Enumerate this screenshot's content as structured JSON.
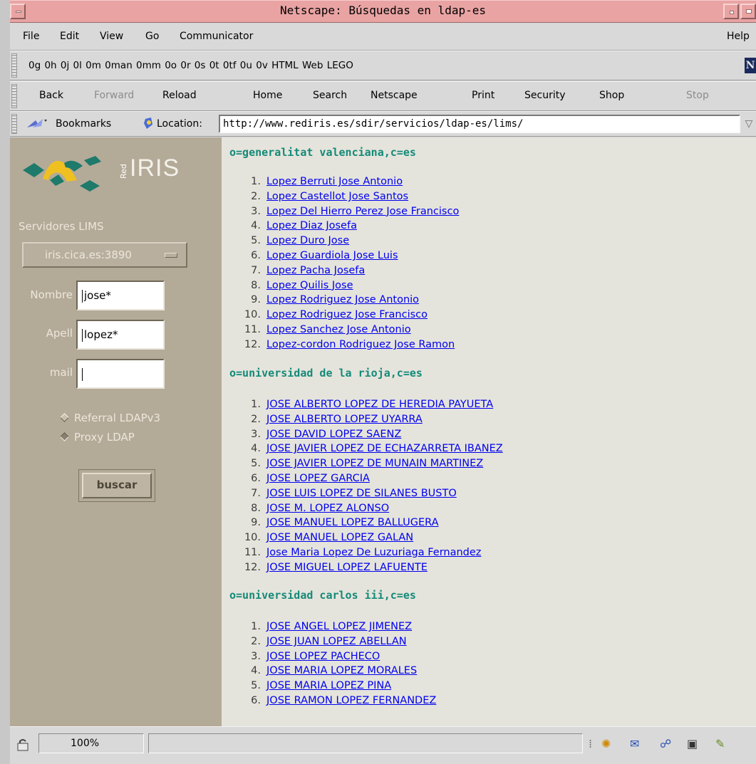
{
  "window": {
    "title": "Netscape: Búsquedas en ldap-es"
  },
  "menubar": {
    "items": [
      "File",
      "Edit",
      "View",
      "Go",
      "Communicator"
    ],
    "help": "Help"
  },
  "personal_toolbar": {
    "links": "0g 0h 0j 0l 0m 0man 0mm 0o 0r 0s 0t 0tf 0u 0v HTML Web LEGO"
  },
  "nav_toolbar": {
    "buttons": [
      "Back",
      "Forward",
      "Reload",
      "Home",
      "Search",
      "Netscape",
      "Print",
      "Security",
      "Shop",
      "Stop"
    ]
  },
  "location_bar": {
    "bookmarks_label": "Bookmarks",
    "location_label": "Location:",
    "url": "http://www.rediris.es/sdir/servicios/ldap-es/lims/"
  },
  "sidebar": {
    "logo_red": "Red",
    "logo_iris": "IRIS",
    "servers_label": "Servidores LIMS",
    "server_selected": "iris.cica.es:3890",
    "nombre_label": "Nombre",
    "nombre_value": "jose*",
    "apell_label": "Apell",
    "apell_value": "lopez*",
    "mail_label": "mail",
    "mail_value": "",
    "radio_referral": "Referral LDAPv3",
    "radio_proxy": "Proxy LDAP",
    "search_button": "buscar"
  },
  "results": [
    {
      "org": "o=generalitat valenciana,c=es",
      "people": [
        "Lopez Berruti Jose Antonio",
        "Lopez Castellot Jose Santos",
        "Lopez Del Hierro Perez Jose Francisco",
        "Lopez Diaz Josefa",
        "Lopez Duro Jose",
        "Lopez Guardiola Jose Luis",
        "Lopez Pacha Josefa",
        "Lopez Quilis Jose",
        "Lopez Rodriguez Jose Antonio",
        "Lopez Rodriguez Jose Francisco",
        "Lopez Sanchez Jose Antonio",
        "Lopez-cordon Rodriguez Jose Ramon"
      ]
    },
    {
      "org": "o=universidad de la rioja,c=es",
      "people": [
        "JOSE ALBERTO LOPEZ DE HEREDIA PAYUETA",
        "JOSE ALBERTO LOPEZ UYARRA",
        "JOSE DAVID LOPEZ SAENZ",
        "JOSE JAVIER LOPEZ DE ECHAZARRETA IBANEZ",
        "JOSE JAVIER LOPEZ DE MUNAIN MARTINEZ",
        "JOSE LOPEZ GARCIA",
        "JOSE LUIS LOPEZ DE SILANES BUSTO",
        "JOSE M. LOPEZ ALONSO",
        "JOSE MANUEL LOPEZ BALLUGERA",
        "JOSE MANUEL LOPEZ GALAN",
        "Jose Maria Lopez De Luzuriaga Fernandez",
        "JOSE MIGUEL LOPEZ LAFUENTE"
      ]
    },
    {
      "org": "o=universidad carlos iii,c=es",
      "people": [
        "JOSE ANGEL LOPEZ JIMENEZ",
        "JOSE JUAN LOPEZ ABELLAN",
        "JOSE LOPEZ PACHECO",
        "JOSE MARIA LOPEZ MORALES",
        "JOSE MARIA LOPEZ PINA",
        "JOSE RAMON LOPEZ FERNANDEZ"
      ]
    }
  ],
  "statusbar": {
    "zoom": "100%"
  },
  "colors": {
    "titlebar": "#e9a3a3",
    "sidebar": "#b4aa98",
    "content": "#e5e4dc",
    "org_heading": "#148a78",
    "link": "#0000ee"
  }
}
